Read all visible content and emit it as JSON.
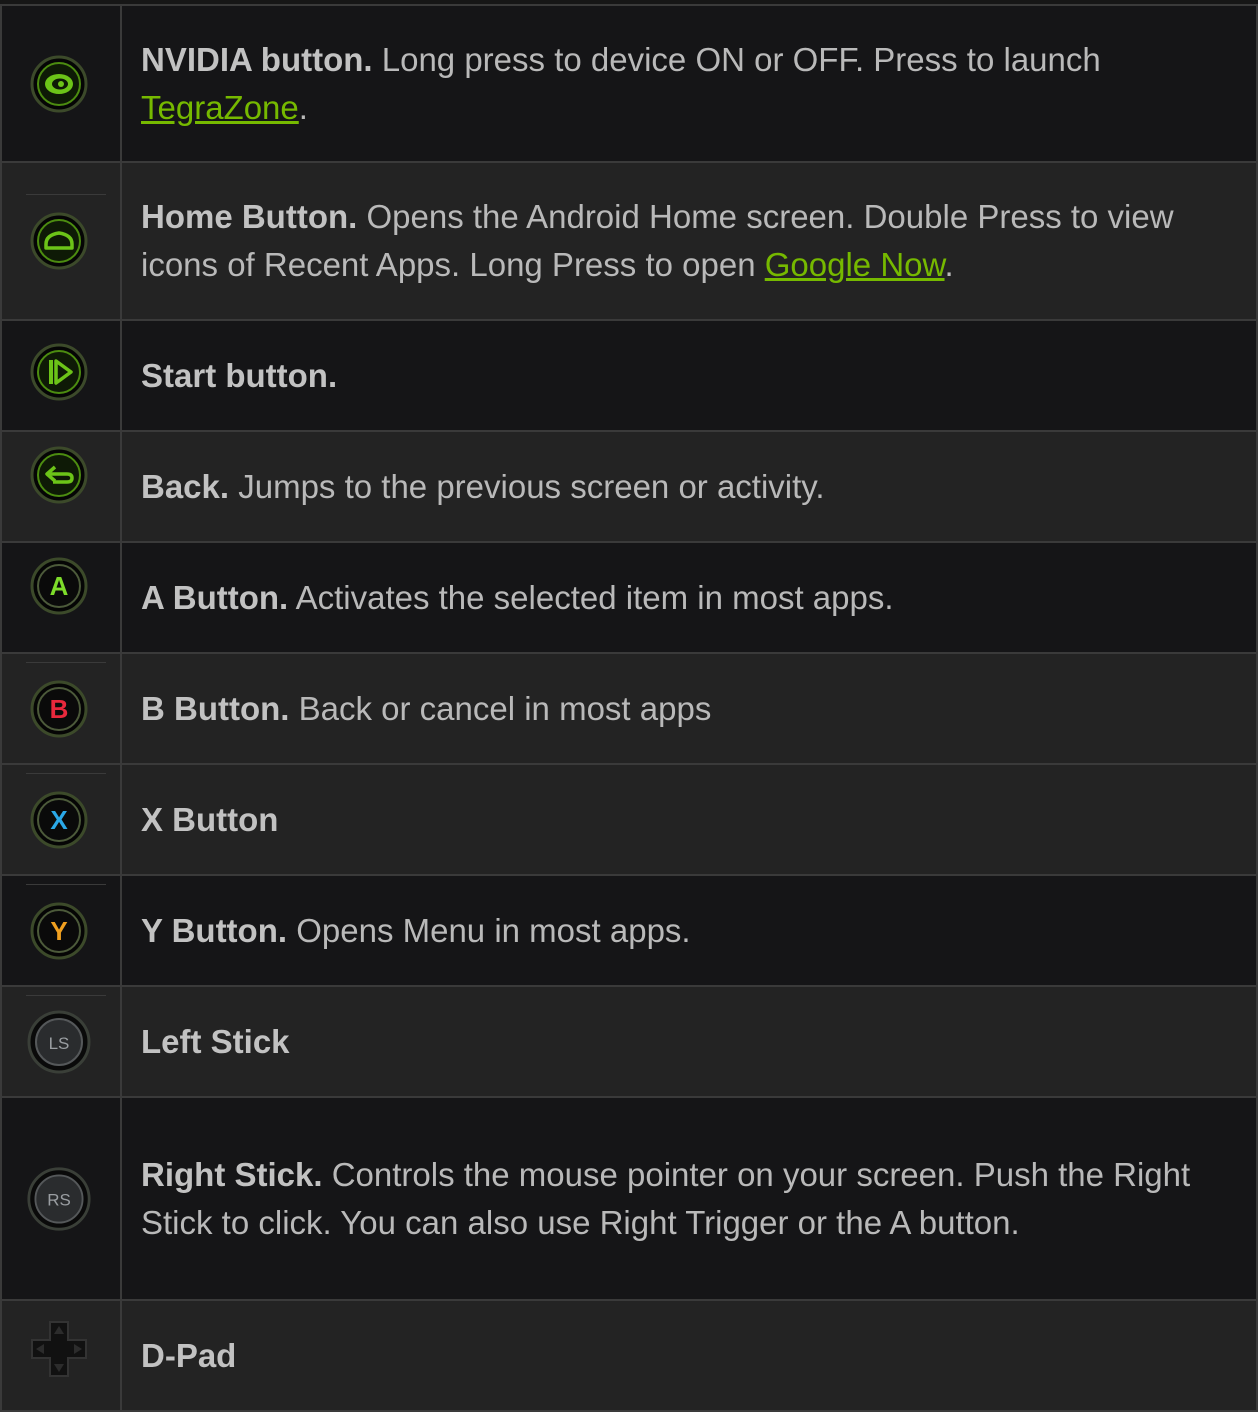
{
  "rows": [
    {
      "icon": "nvidia-button-icon",
      "title": "NVIDIA button.",
      "text": " Long press to device ON or OFF. Press to launch ",
      "link": "TegraZone",
      "after": "."
    },
    {
      "icon": "home-button-icon",
      "title": "Home Button.",
      "text": " Opens the Android Home screen. Double Press to view icons of Recent Apps. Long Press to open ",
      "link": "Google Now",
      "after": "."
    },
    {
      "icon": "start-button-icon",
      "title": "Start button.",
      "text": ""
    },
    {
      "icon": "back-button-icon",
      "title": "Back.",
      "text": " Jumps to the previous screen or activity."
    },
    {
      "icon": "a-button-icon",
      "title": "A Button.",
      "text": " Activates the selected item in most apps.",
      "glyph": "A",
      "glyph_color": "#7ddc2a"
    },
    {
      "icon": "b-button-icon",
      "title": "B Button.",
      "text": " Back or cancel in most apps",
      "glyph": "B",
      "glyph_color": "#e8283c"
    },
    {
      "icon": "x-button-icon",
      "title": "X Button",
      "text": "",
      "glyph": "X",
      "glyph_color": "#2aa8e8"
    },
    {
      "icon": "y-button-icon",
      "title": "Y Button.",
      "text": " Opens Menu in most apps.",
      "glyph": "Y",
      "glyph_color": "#f0a020"
    },
    {
      "icon": "left-stick-icon",
      "title": "Left Stick",
      "text": "",
      "glyph": "LS"
    },
    {
      "icon": "right-stick-icon",
      "title": "Right Stick.",
      "text": " Controls the mouse pointer on your screen. Push the Right Stick to click. You can also use Right Trigger or the A button.",
      "glyph": "RS"
    },
    {
      "icon": "d-pad-icon",
      "title": "D-Pad",
      "text": ""
    }
  ],
  "colors": {
    "link": "#76b900",
    "nvidia_green": "#76b900"
  }
}
